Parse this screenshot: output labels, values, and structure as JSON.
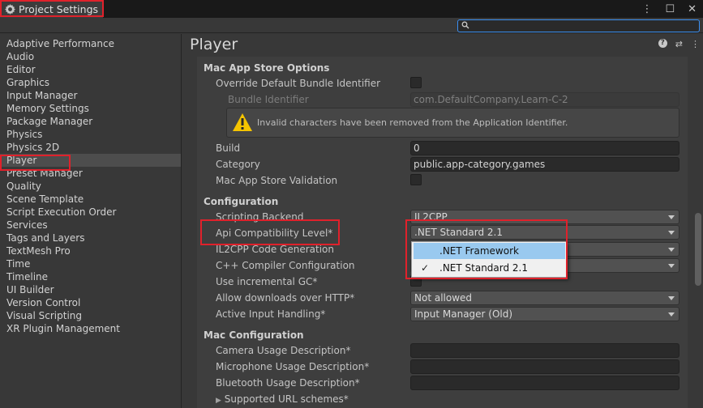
{
  "window": {
    "tab_title": "Project Settings",
    "icons": [
      "gear-icon",
      "more-icon",
      "maximize-icon",
      "close-icon"
    ]
  },
  "search": {
    "placeholder": "",
    "value": ""
  },
  "sidebar": {
    "items": [
      {
        "label": "Adaptive Performance"
      },
      {
        "label": "Audio"
      },
      {
        "label": "Editor"
      },
      {
        "label": "Graphics"
      },
      {
        "label": "Input Manager"
      },
      {
        "label": "Memory Settings"
      },
      {
        "label": "Package Manager"
      },
      {
        "label": "Physics"
      },
      {
        "label": "Physics 2D"
      },
      {
        "label": "Player",
        "selected": true
      },
      {
        "label": "Preset Manager"
      },
      {
        "label": "Quality"
      },
      {
        "label": "Scene Template"
      },
      {
        "label": "Script Execution Order"
      },
      {
        "label": "Services"
      },
      {
        "label": "Tags and Layers"
      },
      {
        "label": "TextMesh Pro"
      },
      {
        "label": "Time"
      },
      {
        "label": "Timeline"
      },
      {
        "label": "UI Builder"
      },
      {
        "label": "Version Control"
      },
      {
        "label": "Visual Scripting"
      },
      {
        "label": "XR Plugin Management"
      }
    ]
  },
  "main": {
    "title": "Player",
    "mac_app_store": {
      "header": "Mac App Store Options",
      "override_label": "Override Default Bundle Identifier",
      "bundle_label": "Bundle Identifier",
      "bundle_value": "com.DefaultCompany.Learn-C-2",
      "warning": "Invalid characters have been removed from the Application Identifier.",
      "build_label": "Build",
      "build_value": "0",
      "category_label": "Category",
      "category_value": "public.app-category.games",
      "validation_label": "Mac App Store Validation"
    },
    "configuration": {
      "header": "Configuration",
      "scripting_backend_label": "Scripting Backend",
      "scripting_backend_value": "IL2CPP",
      "api_level_label": "Api Compatibility Level*",
      "api_level_value": ".NET Standard 2.1",
      "il2cpp_codegen_label": "IL2CPP Code Generation",
      "cpp_compiler_label": "C++ Compiler Configuration",
      "incremental_gc_label": "Use incremental GC*",
      "allow_http_label": "Allow downloads over HTTP*",
      "allow_http_value": "Not allowed",
      "input_handling_label": "Active Input Handling*",
      "input_handling_value": "Input Manager (Old)"
    },
    "mac_configuration": {
      "header": "Mac Configuration",
      "camera_label": "Camera Usage Description*",
      "microphone_label": "Microphone Usage Description*",
      "bluetooth_label": "Bluetooth Usage Description*",
      "url_schemes_label": "Supported URL schemes*"
    }
  },
  "popup": {
    "options": [
      ".NET Framework",
      ".NET Standard 2.1"
    ],
    "highlighted": ".NET Framework",
    "checked": ".NET Standard 2.1",
    "check_glyph": "✓"
  },
  "colors": {
    "highlight_box": "#e0212b",
    "search_border": "#3b8ff0",
    "popup_highlight": "#99c9ef"
  }
}
